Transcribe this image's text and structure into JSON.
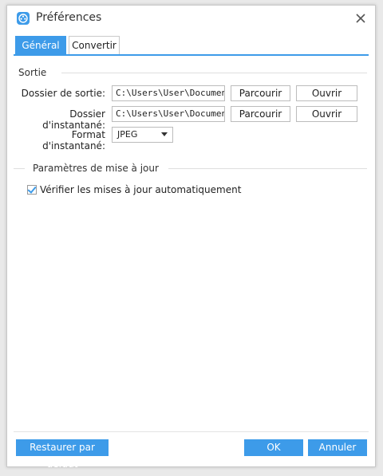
{
  "window": {
    "title": "Préférences"
  },
  "tabs": [
    {
      "label": "Général",
      "active": true
    },
    {
      "label": "Convertir",
      "active": false
    }
  ],
  "sortie": {
    "header": "Sortie",
    "output_folder": {
      "label": "Dossier de sortie:",
      "value": "C:\\Users\\User\\Documents\\A",
      "browse_label": "Parcourir",
      "open_label": "Ouvrir"
    },
    "snapshot_folder": {
      "label": "Dossier d'instantané:",
      "value": "C:\\Users\\User\\Documents\\A",
      "browse_label": "Parcourir",
      "open_label": "Ouvrir"
    },
    "snapshot_format": {
      "label": "Format d'instantané:",
      "selected": "JPEG"
    }
  },
  "update": {
    "header": "Paramètres de mise à jour",
    "auto_check_label": "Vérifier les mises à jour automatiquement",
    "auto_check_checked": true
  },
  "footer": {
    "restore_label": "Restaurer par défaut",
    "ok_label": "OK",
    "cancel_label": "Annuler"
  },
  "colors": {
    "accent": "#3d9be9"
  }
}
